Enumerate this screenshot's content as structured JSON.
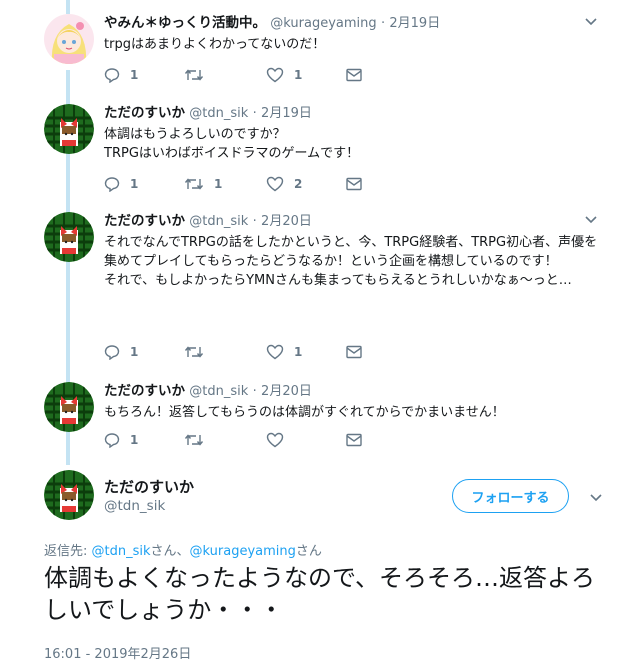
{
  "tweets": [
    {
      "name": "やみん＊ゆっくり活動中。",
      "handle": "@kurageyaming",
      "dot": "·",
      "date": "2月19日",
      "text": "trpgはあまりよくわかってないのだ！",
      "replies": "1",
      "retweets": "",
      "likes": "1",
      "avatar_icon": "anime-girl-avatar"
    },
    {
      "name": "ただのすいか",
      "handle": "@tdn_sik",
      "dot": "·",
      "date": "2月19日",
      "text": "体調はもうよろしいのですか？\nTRPGはいわばボイスドラマのゲームです！",
      "replies": "1",
      "retweets": "1",
      "likes": "2",
      "avatar_icon": "watermelon-avatar"
    },
    {
      "name": "ただのすいか",
      "handle": "@tdn_sik",
      "dot": "·",
      "date": "2月20日",
      "text": "それでなんでTRPGの話をしたかというと、今、TRPG経験者、TRPG初心者、声優を集めてプレイしてもらったらどうなるか！という企画を構想しているのです！\nそれで、もしよかったらYMNさんも集まってもらえるとうれしいかなぁ～っと…",
      "replies": "1",
      "retweets": "",
      "likes": "1",
      "avatar_icon": "watermelon-avatar"
    },
    {
      "name": "ただのすいか",
      "handle": "@tdn_sik",
      "dot": "·",
      "date": "2月20日",
      "text": "もちろん！返答してもらうのは体調がすぐれてからでかまいません！",
      "replies": "1",
      "retweets": "",
      "likes": "",
      "avatar_icon": "watermelon-avatar"
    }
  ],
  "main": {
    "name": "ただのすいか",
    "handle": "@tdn_sik",
    "follow_label": "フォローする",
    "reply_prefix": "返信先: ",
    "reply_mention_1": "@tdn_sik",
    "reply_sep": "さん、",
    "reply_mention_2": "@kurageyaming",
    "reply_suffix": "さん",
    "text": "体調もよくなったようなので、そろそろ…返答よろしいでしょうか・・・",
    "timestamp": "16:01 - 2019年2月26日"
  },
  "colors": {
    "accent": "#1da1f2",
    "secondary_text": "#657786",
    "thread_line": "#c4e3f3"
  }
}
